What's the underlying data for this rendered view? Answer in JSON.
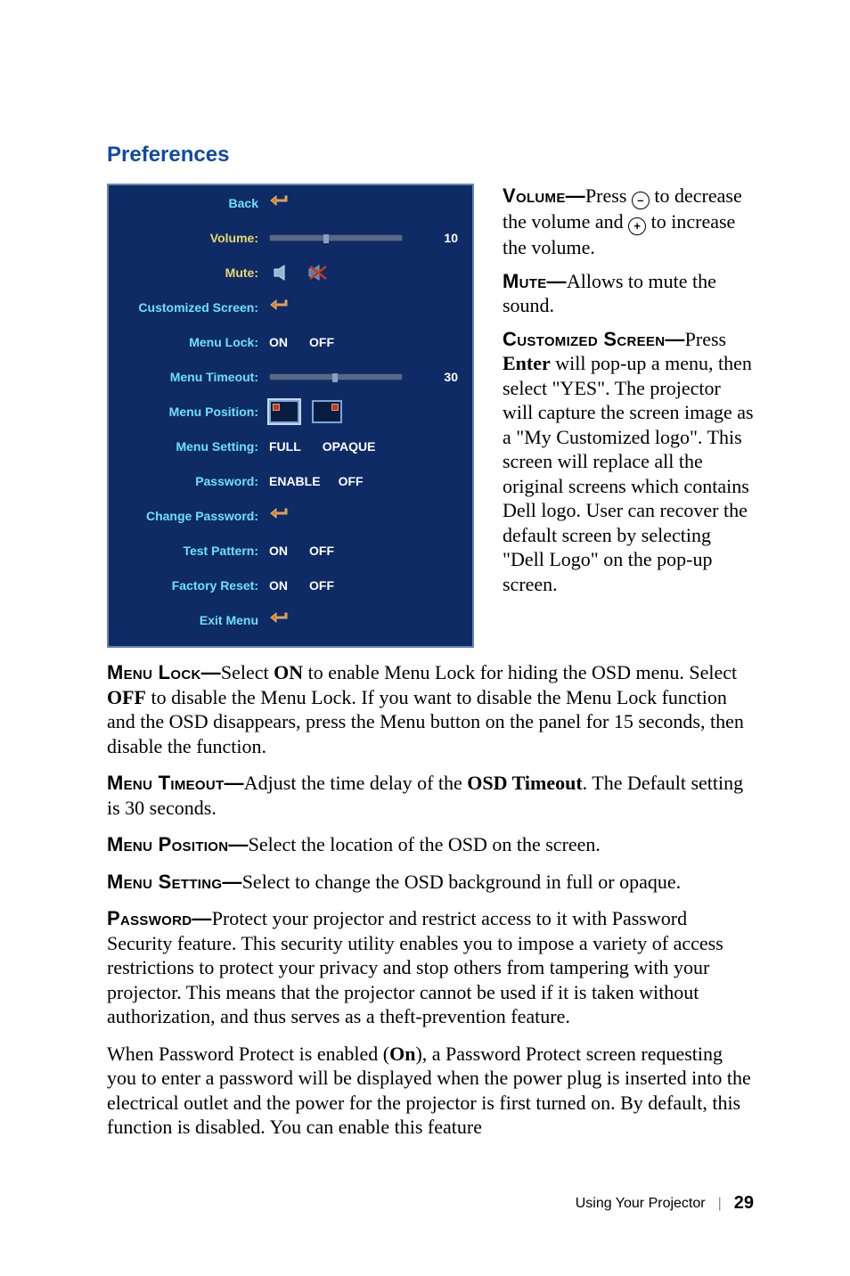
{
  "section_title": "Preferences",
  "osd": {
    "back": "Back",
    "volume": {
      "label": "Volume:",
      "value": "10"
    },
    "mute": {
      "label": "Mute:"
    },
    "cust_screen": {
      "label": "Customized Screen:"
    },
    "menu_lock": {
      "label": "Menu Lock:",
      "on": "ON",
      "off": "OFF"
    },
    "menu_timeout": {
      "label": "Menu Timeout:",
      "value": "30"
    },
    "menu_position": {
      "label": "Menu Position:"
    },
    "menu_setting": {
      "label": "Menu Setting:",
      "full": "FULL",
      "opaque": "OPAQUE"
    },
    "password": {
      "label": "Password:",
      "enable": "ENABLE",
      "off": "OFF"
    },
    "change_pw": {
      "label": "Change Password:"
    },
    "test_pattern": {
      "label": "Test Pattern:",
      "on": "ON",
      "off": "OFF"
    },
    "factory_reset": {
      "label": "Factory Reset:",
      "on": "ON",
      "off": "OFF"
    },
    "exit": "Exit Menu"
  },
  "right": {
    "volume_kw": "Volume—",
    "volume_txt1": "Press ",
    "volume_txt2": " to decrease the volume and ",
    "volume_txt3": " to increase the volume.",
    "mute_kw": "Mute—",
    "mute_txt": "Allows to mute the sound.",
    "cust_kw": "Customized Screen—",
    "cust_txt1": "Press ",
    "cust_enter": "Enter",
    "cust_txt2": " will pop-up a menu, then select \"YES\". The projector will capture the screen image as a \"My Customized logo\". This screen will replace all the original screens which contains Dell logo. User can recover the default screen by selecting \"Dell Logo\" on the pop-up screen."
  },
  "body": {
    "ml_kw": "Menu Lock—",
    "ml_txt1": "Select ",
    "ml_on": "ON",
    "ml_txt2": " to enable Menu Lock for hiding the OSD menu. Select ",
    "ml_off": "OFF",
    "ml_txt3": " to disable the Menu Lock. If you want to disable the Menu Lock function and the OSD disappears, press the Menu button on the panel for 15 seconds, then disable the function.",
    "mt_kw": "Menu Timeout—",
    "mt_txt1": "Adjust the time delay of the ",
    "mt_bold": "OSD Timeout",
    "mt_txt2": ". The Default setting is 30 seconds.",
    "mp_kw": "Menu Position—",
    "mp_txt": "Select the location of the OSD on the screen.",
    "ms_kw": "Menu Setting—",
    "ms_txt": "Select to change the OSD background in full or opaque.",
    "pw_kw": "Password—",
    "pw_txt": "Protect your projector and restrict access to it with Password Security feature. This security utility enables you to impose a variety of access restrictions to protect your privacy and stop others from tampering with your projector. This means that the projector cannot be used if it is taken without authorization, and thus serves as a theft-prevention feature.",
    "pw2_txt1": "When Password Protect is enabled (",
    "pw2_on": "On",
    "pw2_txt2": "), a Password Protect screen requesting you to enter a password will be displayed when the power plug is inserted into the electrical outlet and the power for the projector is first turned on. By default, this function is disabled. You can enable this feature"
  },
  "footer": {
    "chapter": "Using Your Projector",
    "page": "29"
  },
  "buttons": {
    "minus": "–",
    "plus": "+"
  }
}
